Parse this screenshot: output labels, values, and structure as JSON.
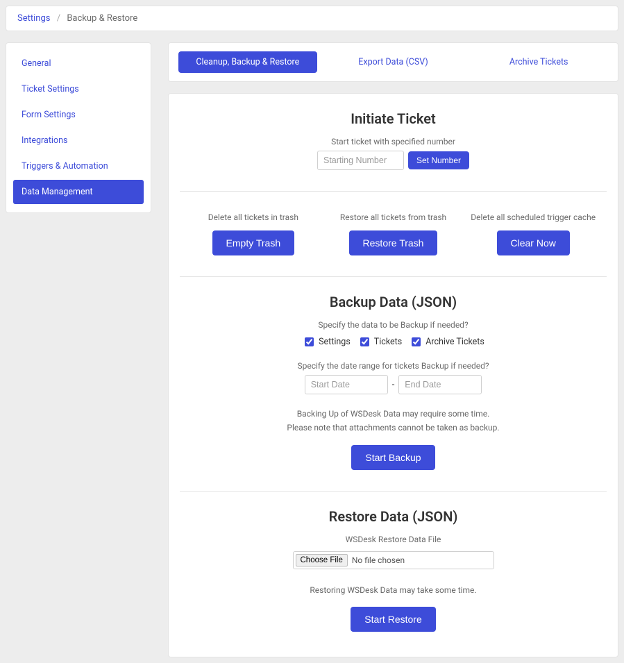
{
  "breadcrumb": {
    "root": "Settings",
    "current": "Backup & Restore"
  },
  "sidebar": {
    "items": [
      {
        "label": "General"
      },
      {
        "label": "Ticket Settings"
      },
      {
        "label": "Form Settings"
      },
      {
        "label": "Integrations"
      },
      {
        "label": "Triggers & Automation"
      },
      {
        "label": "Data Management",
        "active": true
      }
    ]
  },
  "tabs": {
    "items": [
      {
        "label": "Cleanup, Backup & Restore",
        "active": true
      },
      {
        "label": "Export Data (CSV)"
      },
      {
        "label": "Archive Tickets"
      }
    ]
  },
  "initiate": {
    "title": "Initiate Ticket",
    "subtitle": "Start ticket with specified number",
    "placeholder": "Starting Number",
    "button": "Set Number"
  },
  "cleanup": {
    "cells": [
      {
        "desc": "Delete all tickets in trash",
        "button": "Empty Trash"
      },
      {
        "desc": "Restore all tickets from trash",
        "button": "Restore Trash"
      },
      {
        "desc": "Delete all scheduled trigger cache",
        "button": "Clear Now"
      }
    ]
  },
  "backup": {
    "title": "Backup Data (JSON)",
    "q1": "Specify the data to be Backup if needed?",
    "checkboxes": [
      {
        "label": "Settings",
        "checked": true
      },
      {
        "label": "Tickets",
        "checked": true
      },
      {
        "label": "Archive Tickets",
        "checked": true
      }
    ],
    "q2": "Specify the date range for tickets Backup if needed?",
    "start_ph": "Start Date",
    "end_ph": "End Date",
    "range_sep": "-",
    "note1": "Backing Up of WSDesk Data may require some time.",
    "note2": "Please note that attachments cannot be taken as backup.",
    "button": "Start Backup"
  },
  "restore": {
    "title": "Restore Data (JSON)",
    "subtitle": "WSDesk Restore Data File",
    "choose": "Choose File",
    "nofile": "No file chosen",
    "note": "Restoring WSDesk Data may take some time.",
    "button": "Start Restore"
  }
}
